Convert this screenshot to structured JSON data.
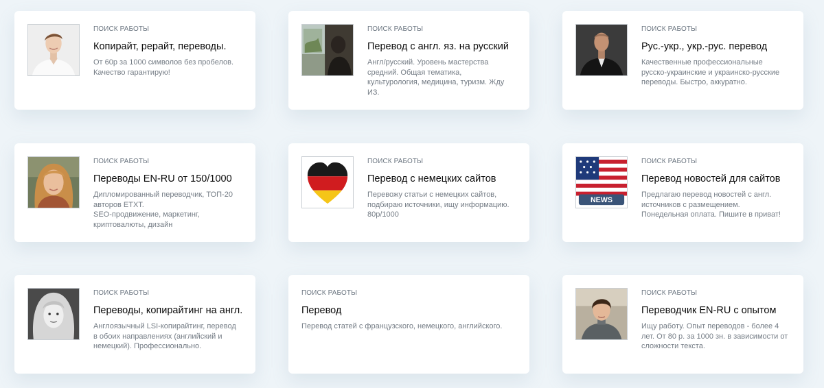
{
  "cards": [
    {
      "eyebrow": "Поиск работы",
      "title": "Копирайт, рерайт, переводы.",
      "description": "От 60р за 1000 символов без пробелов.\nКачество гарантирую!",
      "avatar": "man-white-shirt-avatar"
    },
    {
      "eyebrow": "Поиск работы",
      "title": "Перевод с англ. яз. на русский",
      "description": "Англ/русский. Уровень мастерства\nсредний. Общая тематика,\nкультурология, медицина, туризм. Жду\nИЗ.",
      "avatar": "person-by-window-avatar"
    },
    {
      "eyebrow": "Поиск работы",
      "title": "Рус.-укр., укр.-рус. перевод",
      "description": "Качественные профессиональные\nрусско-украинские и украинско-русские\nпереводы. Быстро, аккуратно.",
      "avatar": "man-dark-suit-avatar"
    },
    {
      "eyebrow": "Поиск работы",
      "title": "Переводы EN-RU от 150/1000",
      "description": "Дипломированный переводчик, ТОП-20\nавторов ETXT.\nSEO-продвижение, маркетинг,\nкриптовалюты, дизайн",
      "avatar": "woman-blonde-avatar"
    },
    {
      "eyebrow": "Поиск работы",
      "title": "Перевод с немецких сайтов",
      "description": "Перевожу статьи с немецких сайтов,\nподбираю источники, ищу информацию.\n80р/1000",
      "avatar": "german-flag-heart-avatar"
    },
    {
      "eyebrow": "Поиск работы",
      "title": "Перевод новостей для сайтов",
      "description": "Предлагаю перевод новостей с англ.\nисточников с размещением.\nПонедельная оплата. Пишите в приват!",
      "avatar": "us-flag-news-avatar"
    },
    {
      "eyebrow": "Поиск работы",
      "title": "Переводы, копирайтинг на англ.",
      "description": "Англоязычный LSI-копирайтинг, перевод\nв обоих направлениях (английский и\nнемецкий). Профессионально.",
      "avatar": "woman-bw-avatar"
    },
    {
      "eyebrow": "Поиск работы",
      "title": "Перевод",
      "description": "Перевод статей с французского, немецкого, английского.",
      "avatar": null
    },
    {
      "eyebrow": "Поиск работы",
      "title": "Переводчик EN-RU с опытом",
      "description": "Ищу работу. Опыт переводов - более 4\nлет. От 80 р. за 1000 зн. в зависимости от\nсложности текста.",
      "avatar": "woman-short-hair-avatar"
    }
  ],
  "colors": {
    "page_background": "#eef4f8",
    "card_background": "#ffffff",
    "eyebrow_text": "#6d7782",
    "title_text": "#0b0b0b",
    "description_text": "#747c85"
  }
}
